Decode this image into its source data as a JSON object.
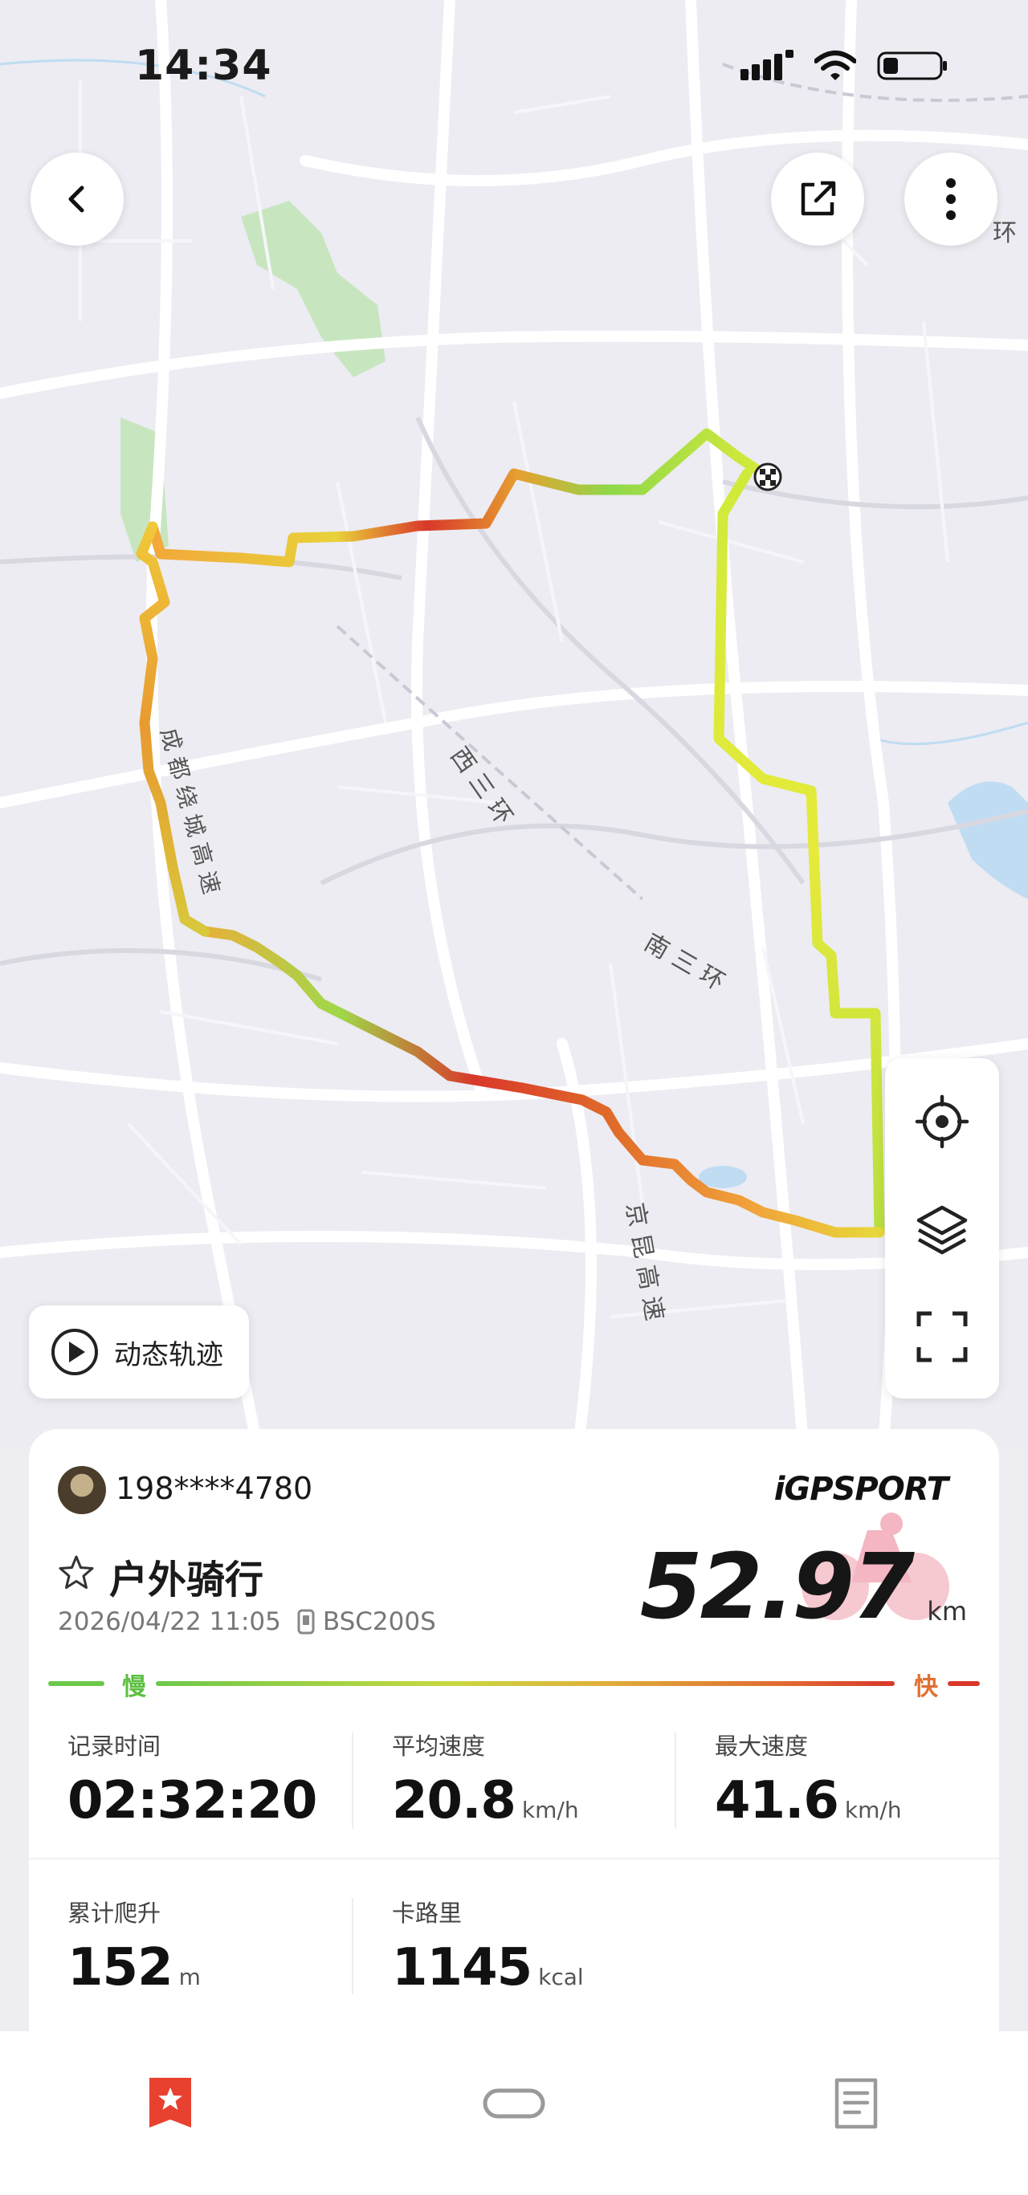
{
  "status_bar": {
    "time": "14:34"
  },
  "map": {
    "road_labels": [
      "西三环",
      "南三环",
      "京昆高速",
      "成都绕城高速",
      "环"
    ],
    "dynamic_track_label": "动态轨迹",
    "route_colors": {
      "slow": "#7fd651",
      "mid": "#e6ea3a",
      "fast": "#d9382a"
    }
  },
  "activity": {
    "user": "198****4780",
    "brand": "iGPSPORT",
    "type": "户外骑行",
    "datetime": "2026/04/22 11:05",
    "device": "BSC200S",
    "distance": "52.97",
    "distance_unit": "km",
    "speed_legend": {
      "slow": "慢",
      "fast": "快"
    },
    "stats": [
      {
        "label": "记录时间",
        "value": "02:32:20",
        "unit": ""
      },
      {
        "label": "平均速度",
        "value": "20.8",
        "unit": "km/h"
      },
      {
        "label": "最大速度",
        "value": "41.6",
        "unit": "km/h"
      },
      {
        "label": "累计爬升",
        "value": "152",
        "unit": "m"
      },
      {
        "label": "卡路里",
        "value": "1145",
        "unit": "kcal"
      }
    ]
  },
  "bottom_nav": {
    "items": [
      "activity-tab-icon",
      "device-tab-icon",
      "record-tab-icon"
    ],
    "active_color": "#e8412f"
  }
}
